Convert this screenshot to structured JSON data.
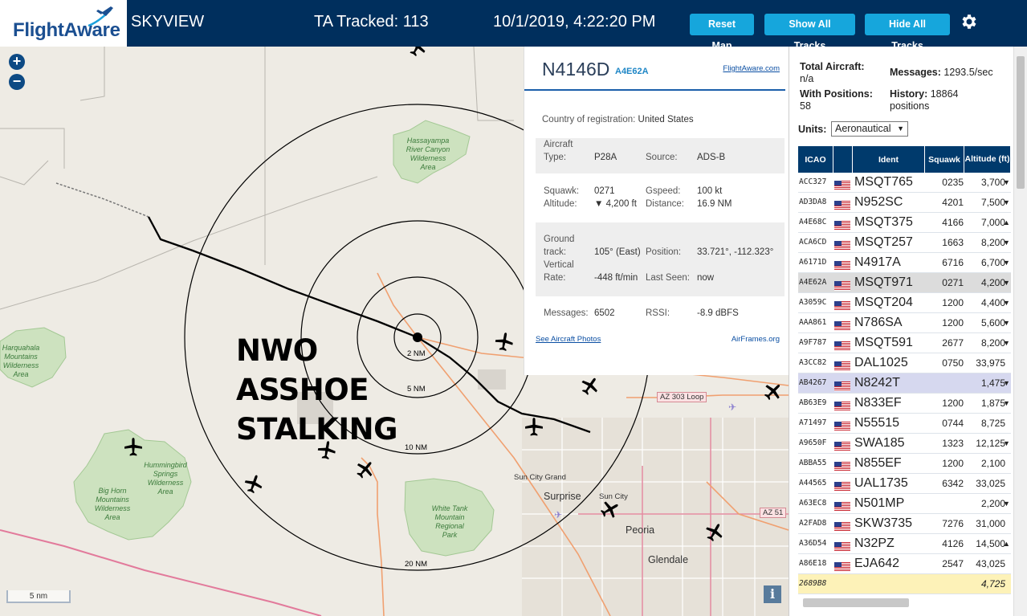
{
  "header": {
    "logo_text": "FlightAware",
    "app_name": "SKYVIEW",
    "tracked": "TA Tracked: 113",
    "datetime": "10/1/2019, 4:22:20 PM",
    "btn_reset": "Reset Map",
    "btn_show": "Show All Tracks",
    "btn_hide": "Hide All Tracks",
    "settings_icon": "gear-icon"
  },
  "map": {
    "zoom_in": "+",
    "zoom_out": "−",
    "overlay_line1": "NWO",
    "overlay_line2": "ASSHOE",
    "overlay_line3": "STALKING",
    "scale_label": "5 nm",
    "info": "i",
    "range_labels": [
      "2 NM",
      "5 NM",
      "10 NM",
      "20 NM"
    ],
    "place_labels": {
      "hassayampa": [
        "Hassayampa",
        "River Canyon",
        "Wilderness",
        "Area"
      ],
      "harquahala": [
        "Harquahala",
        "Mountains",
        "Wilderness",
        "Area"
      ],
      "hummingbird": [
        "Hummingbird",
        "Springs",
        "Wilderness",
        "Area"
      ],
      "bighorn": [
        "Big Horn",
        "Mountains",
        "Wilderness",
        "Area"
      ],
      "whitetank": [
        "White Tank",
        "Mountain",
        "Regional",
        "Park"
      ],
      "surprise": "Surprise",
      "sun_city": "Sun City",
      "sun_city_grand": "Sun City Grand",
      "peoria": "Peoria",
      "glendale": "Glendale",
      "az303": "AZ 303 Loop",
      "az51": "AZ 51"
    }
  },
  "detail": {
    "registration": "N4146D",
    "hex": "A4E62A",
    "flightaware_link": "FlightAware.com",
    "country_label": "Country of registration:",
    "country": "United States",
    "aircraft_type_label_1": "Aircraft",
    "aircraft_type_label_2": "Type:",
    "aircraft_type": "P28A",
    "source_label": "Source:",
    "source": "ADS-B",
    "squawk_label": "Squawk:",
    "squawk": "0271",
    "gspeed_label": "Gspeed:",
    "gspeed": "100 kt",
    "altitude_label": "Altitude:",
    "altitude": "▼ 4,200 ft",
    "distance_label": "Distance:",
    "distance": "16.9 NM",
    "ground_label_1": "Ground",
    "ground_label_2": "track:",
    "ground_track": "105° (East)",
    "position_label": "Position:",
    "position": "33.721°, -112.323°",
    "vrate_label_1": "Vertical",
    "vrate_label_2": "Rate:",
    "vertical_rate": "-448 ft/min",
    "last_seen_label": "Last Seen:",
    "last_seen": "now",
    "messages_label": "Messages:",
    "messages": "6502",
    "rssi_label": "RSSI:",
    "rssi": "-8.9 dBFS",
    "photos_link": "See Aircraft Photos",
    "airframes_link": "AirFrames.org"
  },
  "panel": {
    "total_aircraft_label": "Total Aircraft:",
    "total_aircraft": "n/a",
    "messages_label": "Messages:",
    "messages": "1293.5/sec",
    "with_positions_label": "With Positions:",
    "with_positions": "58",
    "history_label": "History:",
    "history": "18864",
    "history_unit": "positions",
    "units_label": "Units:",
    "units_value": "Aeronautical",
    "columns": [
      "ICAO",
      "",
      "Ident",
      "Squawk",
      "Altitude (ft)"
    ],
    "rows": [
      {
        "icao": "ACC327",
        "ident": "MSQT765",
        "squawk": "0235",
        "alt": "3,700",
        "trend": "▼"
      },
      {
        "icao": "AD3DA8",
        "ident": "N952SC",
        "squawk": "4201",
        "alt": "7,500",
        "trend": "▼"
      },
      {
        "icao": "A4E68C",
        "ident": "MSQT375",
        "squawk": "4166",
        "alt": "7,000",
        "trend": "▲"
      },
      {
        "icao": "ACA6CD",
        "ident": "MSQT257",
        "squawk": "1663",
        "alt": "8,200",
        "trend": "▼"
      },
      {
        "icao": "A6171D",
        "ident": "N4917A",
        "squawk": "6716",
        "alt": "6,700",
        "trend": "▼"
      },
      {
        "icao": "A4E62A",
        "ident": "MSQT971",
        "squawk": "0271",
        "alt": "4,200",
        "trend": "▼"
      },
      {
        "icao": "A3059C",
        "ident": "MSQT204",
        "squawk": "1200",
        "alt": "4,400",
        "trend": "▼"
      },
      {
        "icao": "AAA861",
        "ident": "N786SA",
        "squawk": "1200",
        "alt": "5,600",
        "trend": "▼"
      },
      {
        "icao": "A9F787",
        "ident": "MSQT591",
        "squawk": "2677",
        "alt": "8,200",
        "trend": "▼"
      },
      {
        "icao": "A3CC82",
        "ident": "DAL1025",
        "squawk": "0750",
        "alt": "33,975",
        "trend": ""
      },
      {
        "icao": "AB4267",
        "ident": "N8242T",
        "squawk": "",
        "alt": "1,475",
        "trend": "▼"
      },
      {
        "icao": "AB63E9",
        "ident": "N833EF",
        "squawk": "1200",
        "alt": "1,875",
        "trend": "▼"
      },
      {
        "icao": "A71497",
        "ident": "N55515",
        "squawk": "0744",
        "alt": "8,725",
        "trend": ""
      },
      {
        "icao": "A9650F",
        "ident": "SWA185",
        "squawk": "1323",
        "alt": "12,125",
        "trend": "▼"
      },
      {
        "icao": "ABBA55",
        "ident": "N855EF",
        "squawk": "1200",
        "alt": "2,100",
        "trend": ""
      },
      {
        "icao": "A44565",
        "ident": "UAL1735",
        "squawk": "6342",
        "alt": "33,025",
        "trend": ""
      },
      {
        "icao": "A63EC8",
        "ident": "N501MP",
        "squawk": "",
        "alt": "2,200",
        "trend": "▼"
      },
      {
        "icao": "A2FAD8",
        "ident": "SKW3735",
        "squawk": "7276",
        "alt": "31,000",
        "trend": ""
      },
      {
        "icao": "A36D54",
        "ident": "N32PZ",
        "squawk": "4126",
        "alt": "14,500",
        "trend": "▲"
      },
      {
        "icao": "A86E18",
        "ident": "EJA642",
        "squawk": "2547",
        "alt": "43,025",
        "trend": ""
      },
      {
        "icao": "2689B8",
        "ident": "",
        "squawk": "",
        "alt": "4,725",
        "trend": ""
      }
    ]
  },
  "colors": {
    "header_bg": "#002f5d",
    "button": "#16a6dc",
    "table_header": "#003a6c",
    "selected_row": "#dcdcdc",
    "highlight_row": "#d6d8ef",
    "last_row": "#fdf2b8",
    "track": "#000000",
    "road": "#f0a070"
  }
}
